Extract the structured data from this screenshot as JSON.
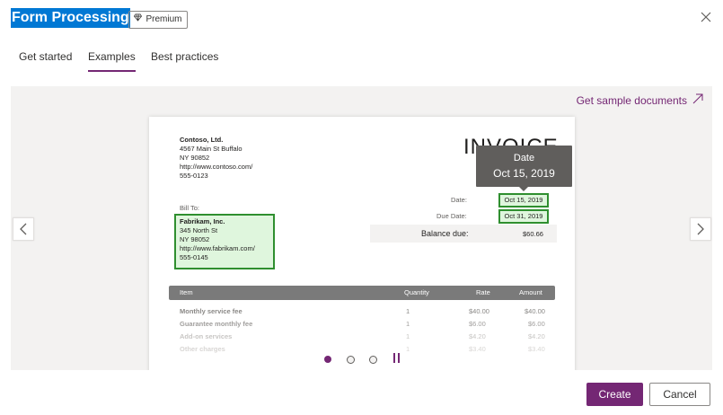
{
  "header": {
    "title": "Form Processing",
    "premium_label": "Premium",
    "premium_icon": "diamond-icon",
    "close_icon": "close-icon"
  },
  "tabs": [
    {
      "label": "Get started",
      "active": false
    },
    {
      "label": "Examples",
      "active": true
    },
    {
      "label": "Best practices",
      "active": false
    }
  ],
  "carousel": {
    "sample_link": "Get sample documents",
    "sample_link_icon": "arrow-up-right-icon",
    "prev_icon": "chevron-left-icon",
    "next_icon": "chevron-right-icon",
    "pager": {
      "count": 3,
      "active": 1,
      "pause_icon": "pause-icon"
    }
  },
  "invoice": {
    "company": {
      "name": "Contoso, Ltd.",
      "line1": "4567 Main St Buffalo",
      "line2": "NY 90852",
      "line3": "http://www.contoso.com/",
      "line4": "555-0123"
    },
    "heading": "INVOICE",
    "tooltip": {
      "label": "Date",
      "value": "Oct 15, 2019"
    },
    "bill_to_label": "Bill To:",
    "bill_to": {
      "name": "Fabrikam, Inc.",
      "line1": "345 North St",
      "line2": "NY 98052",
      "line3": "http://www.fabrikam.com/",
      "line4": "555-0145"
    },
    "date_label": "Date:",
    "date_value": "Oct 15, 2019",
    "due_label": "Due Date:",
    "due_value": "Oct 31, 2019",
    "balance_label": "Balance due:",
    "balance_value": "$60.66",
    "table": {
      "headers": {
        "item": "Item",
        "quantity": "Quantity",
        "rate": "Rate",
        "amount": "Amount"
      },
      "rows": [
        {
          "item": "Monthly service fee",
          "quantity": "1",
          "rate": "$40.00",
          "amount": "$40.00"
        },
        {
          "item": "Guarantee monthly fee",
          "quantity": "1",
          "rate": "$6.00",
          "amount": "$6.00"
        },
        {
          "item": "Add-on services",
          "quantity": "1",
          "rate": "$4.20",
          "amount": "$4.20"
        },
        {
          "item": "Other charges",
          "quantity": "1",
          "rate": "$3.40",
          "amount": "$3.40"
        }
      ]
    }
  },
  "footer": {
    "create_label": "Create",
    "cancel_label": "Cancel"
  },
  "colors": {
    "accent": "#742774",
    "title_highlight": "#0078d4",
    "field_highlight": "#dff6dd",
    "field_border": "#2f8f2f"
  }
}
